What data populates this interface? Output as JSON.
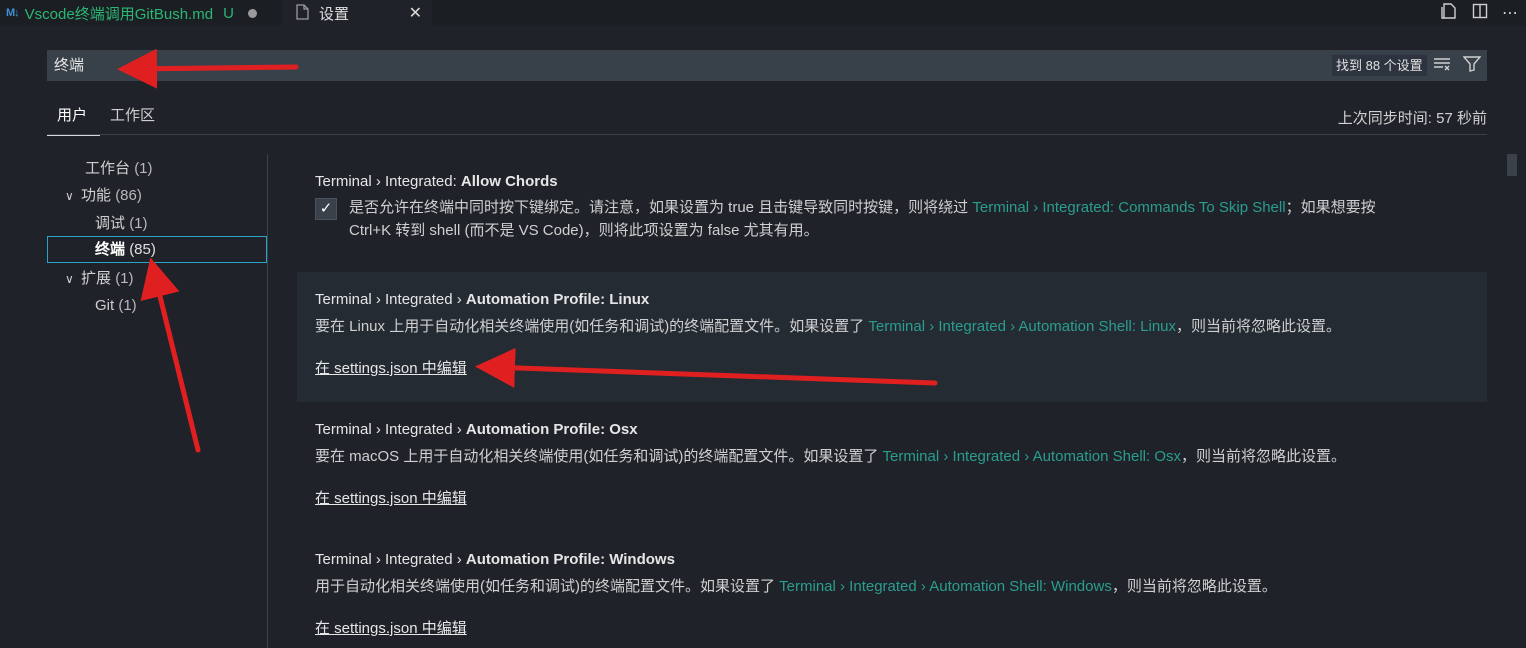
{
  "tabs": [
    {
      "icon": "markdown-icon",
      "label": "Vscode终端调用GitBush.md",
      "status": "U"
    },
    {
      "icon": "file-icon",
      "label": "设置"
    }
  ],
  "search": {
    "value": "终端",
    "result_count": "找到 88 个设置"
  },
  "scopes": {
    "user": "用户",
    "workspace": "工作区"
  },
  "sync_status": "上次同步时间: 57 秒前",
  "toc": {
    "workbench": {
      "label": "工作台",
      "count": "(1)"
    },
    "features": {
      "label": "功能",
      "count": "(86)"
    },
    "debug": {
      "label": "调试",
      "count": "(1)"
    },
    "terminal": {
      "label": "终端",
      "count": "(85)"
    },
    "extensions": {
      "label": "扩展",
      "count": "(1)"
    },
    "git": {
      "label": "Git",
      "count": "(1)"
    }
  },
  "settings": [
    {
      "title_prefix": "Terminal › Integrated: ",
      "title_name": "Allow Chords",
      "checked": true,
      "desc_1": "是否允许在终端中同时按下键绑定。请注意，如果设置为 true 且击键导致同时按键，则将绕过 ",
      "link": "Terminal › Integrated: Commands To Skip Shell",
      "desc_2": "；如果想要按",
      "desc_3": "Ctrl+K 转到 shell (而不是 VS Code)，则将此项设置为 false 尤其有用。"
    },
    {
      "title_prefix": "Terminal › Integrated › ",
      "title_name": "Automation Profile: Linux",
      "desc_1": "要在 Linux 上用于自动化相关终端使用(如任务和调试)的终端配置文件。如果设置了 ",
      "link": "Terminal › Integrated › Automation Shell: Linux",
      "desc_2": "，则当前将忽略此设置。",
      "edit": "在 settings.json 中编辑"
    },
    {
      "title_prefix": "Terminal › Integrated › ",
      "title_name": "Automation Profile: Osx",
      "desc_1": "要在 macOS 上用于自动化相关终端使用(如任务和调试)的终端配置文件。如果设置了 ",
      "link": "Terminal › Integrated › Automation Shell: Osx",
      "desc_2": "，则当前将忽略此设置。",
      "edit": "在 settings.json 中编辑"
    },
    {
      "title_prefix": "Terminal › Integrated › ",
      "title_name": "Automation Profile: Windows",
      "desc_1": "用于自动化相关终端使用(如任务和调试)的终端配置文件。如果设置了 ",
      "link": "Terminal › Integrated › Automation Shell: Windows",
      "desc_2": "，则当前将忽略此设置。",
      "edit": "在 settings.json 中编辑"
    }
  ],
  "colors": {
    "link": "#2a9d8f",
    "annotation_arrow": "#e02020",
    "focus_border": "#2aa4c4"
  }
}
